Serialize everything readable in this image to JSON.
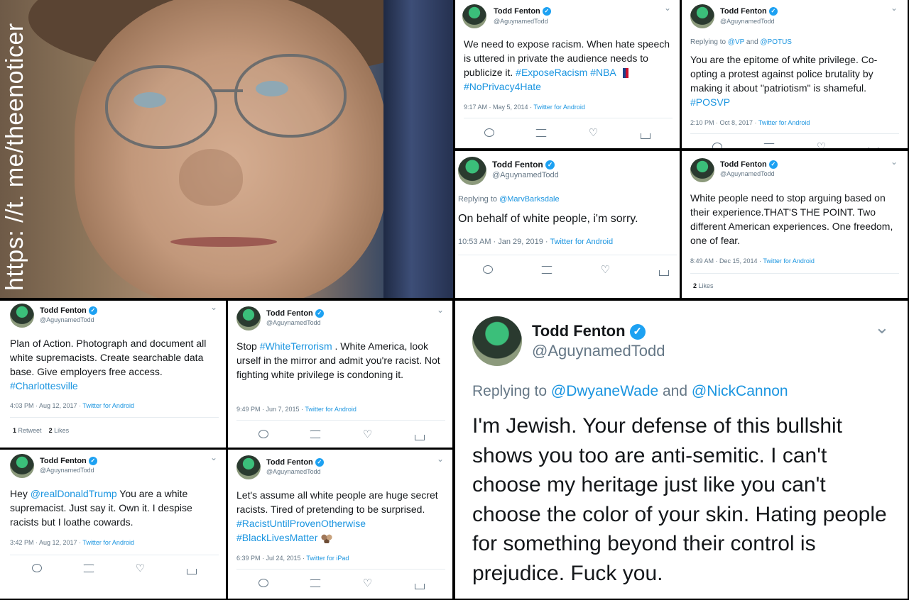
{
  "watermark": "https: //t. me/theenoticer",
  "icons": {
    "verified": "✓",
    "chevron": "⌄",
    "like": "♡"
  },
  "colors": {
    "link": "#1b95e0",
    "verified": "#1da1f2"
  },
  "tweets": [
    {
      "name": "Todd Fenton",
      "handle": "@AguynamedTodd",
      "reply": "",
      "body": [
        "We need to expose racism.  When hate speech is uttered in private the audience needs to publicize it. ",
        "#ExposeRacism #NBA",
        " ",
        "#NoPrivacy4Hate"
      ],
      "time": "9:17 AM · May 5, 2014",
      "via": "Twitter for Android"
    },
    {
      "name": "Todd Fenton",
      "handle": "@AguynamedTodd",
      "reply_prefix": "Replying to ",
      "reply_a": "@VP",
      "reply_and": " and ",
      "reply_b": "@POTUS",
      "body": [
        "You are the epitome of white privilege. Co-opting a protest against police brutality by making it about \"patriotism\" is shameful. ",
        "#POSVP"
      ],
      "time": "2:10 PM · Oct 8, 2017",
      "via": "Twitter for Android"
    },
    {
      "name": "Todd Fenton",
      "handle": "@AguynamedTodd",
      "reply_prefix": "Replying to ",
      "reply_a": "@MarvBarksdale",
      "body": [
        "On behalf of white people,  i'm sorry."
      ],
      "time": "10:53 AM · Jan 29, 2019",
      "via": "Twitter for Android"
    },
    {
      "name": "Todd Fenton",
      "handle": "@AguynamedTodd",
      "body": [
        "White people need to stop arguing based on their experience.THAT'S THE POINT. Two different American experiences. One freedom, one of fear."
      ],
      "time": "8:49 AM · Dec 15, 2014",
      "via": "Twitter for Android",
      "likes_count": "2",
      "likes_label": "Likes"
    },
    {
      "name": "Todd Fenton",
      "handle": "@AguynamedTodd",
      "body": [
        "Plan of Action. Photograph and document all white supremacists. Create searchable data base. Give employers free access. ",
        "#Charlottesville"
      ],
      "time": "4:03 PM · Aug 12, 2017",
      "via": "Twitter for Android",
      "rt_count": "1",
      "rt_label": "Retweet",
      "likes_count": "2",
      "likes_label": "Likes"
    },
    {
      "name": "Todd Fenton",
      "handle": "@AguynamedTodd",
      "body": [
        "Stop ",
        "#WhiteTerrorism",
        " . White America, look urself in the mirror and admit you're racist. Not fighting white privilege is condoning it."
      ],
      "time": "9:49 PM · Jun 7, 2015",
      "via": "Twitter for Android"
    },
    {
      "name": "Todd Fenton",
      "handle": "@AguynamedTodd",
      "body": [
        "Hey ",
        "@realDonaldTrump",
        " You are a white supremacist.  Just say it.  Own it. I despise racists but I loathe cowards."
      ],
      "time": "3:42 PM · Aug 12, 2017",
      "via": "Twitter for Android"
    },
    {
      "name": "Todd Fenton",
      "handle": "@AguynamedTodd",
      "body": [
        "Let's assume all white people are huge secret racists. Tired of pretending to be surprised.  ",
        "#RacistUntilProvenOtherwise #BlackLivesMatter"
      ],
      "time": "6:39 PM · Jul 24, 2015",
      "via": "Twitter for iPad"
    },
    {
      "name": "Todd Fenton",
      "handle": "@AguynamedTodd",
      "reply_prefix": "Replying to ",
      "reply_a": "@DwyaneWade",
      "reply_and": " and ",
      "reply_b": "@NickCannon",
      "body": [
        "I'm Jewish. Your  defense of this bullshit shows you too are anti-semitic. I can't choose my heritage just like you can't choose the color of your skin. Hating people for something beyond their control is prejudice. Fuck you."
      ]
    }
  ]
}
